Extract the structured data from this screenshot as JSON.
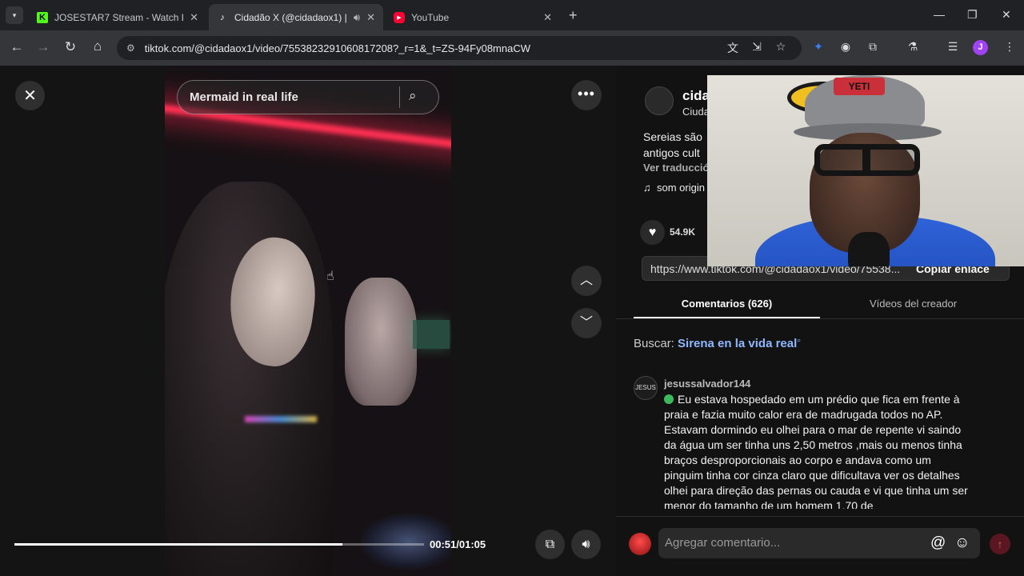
{
  "browser": {
    "tabs": [
      {
        "title": "JOSESTAR7 Stream - Watch Live",
        "favicon": "kick-icon"
      },
      {
        "title": "Cidadão X (@cidadaox1) | T",
        "favicon": "tiktok-icon"
      },
      {
        "title": "YouTube",
        "favicon": "youtube-icon"
      }
    ],
    "url": "tiktok.com/@cidadaox1/video/7553823291060817208?_r=1&_t=ZS-94Fy08mnaCW",
    "profile_initial": "J"
  },
  "viewer": {
    "search_text": "Mermaid in real life",
    "time": "00:51/01:05",
    "progress": 0.8
  },
  "panel": {
    "creator_name": "cida",
    "creator_sub": "Ciuda",
    "desc_line1": "Sereias são",
    "desc_line2": "antigos cult",
    "translate": "Ver traducció",
    "sound": "som origin",
    "likes": "54.9K",
    "link": "https://www.tiktok.com/@cidadaox1/video/75538...",
    "copy_link": "Copiar enlace",
    "webcam_cap_text": "YETI",
    "tabs": {
      "comments": "Comentarios (626)",
      "videos": "Vídeos del creador"
    },
    "search_label": "Buscar:",
    "search_term": "Sirena en la vida real",
    "comment": {
      "avatar_text": "JESUS",
      "user": "jesussalvador144",
      "text": "Eu estava hospedado em um prédio que fica em frente à praia e fazia muito calor era de madrugada todos no AP. Estavam dormindo eu olhei para o mar de repente vi saindo da água um ser tinha uns 2,50 metros ,mais ou menos tinha braços desproporcionais ao corpo e andava como um pinguim tinha cor cinza claro que dificultava ver os detalhes olhei para direção das pernas ou cauda e vi que tinha um ser menor do tamanho de um homem 1,70 de"
    },
    "comment_placeholder": "Agregar comentario..."
  },
  "colors": {
    "accent": "#fe2c55",
    "link": "#8fb8ff"
  }
}
